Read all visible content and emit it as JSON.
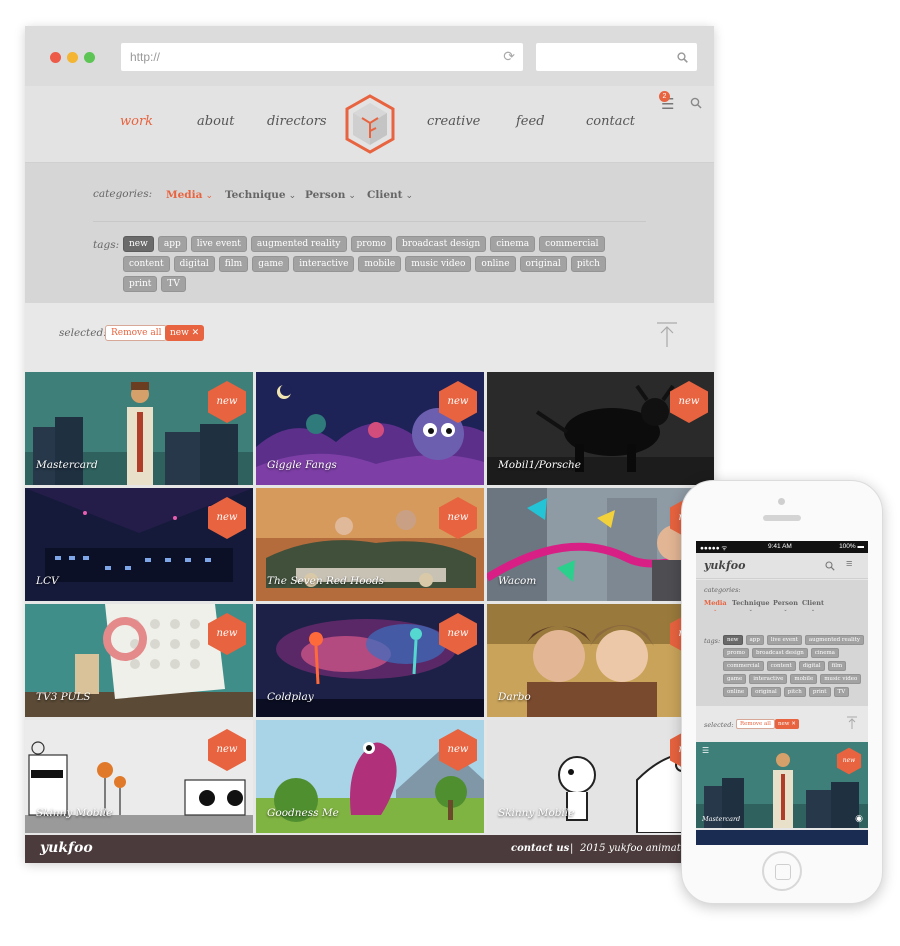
{
  "browser": {
    "url": "http://"
  },
  "nav": {
    "items": [
      {
        "label": "work",
        "active": true
      },
      {
        "label": "about"
      },
      {
        "label": "directors"
      },
      {
        "label": "creative"
      },
      {
        "label": "feed"
      },
      {
        "label": "contact"
      }
    ],
    "notification_count": "2"
  },
  "filters": {
    "categories_label": "categories:",
    "categories": [
      {
        "label": "Media",
        "active": true
      },
      {
        "label": "Technique"
      },
      {
        "label": "Person"
      },
      {
        "label": "Client"
      }
    ],
    "tags_label": "tags:",
    "tags": [
      "new",
      "app",
      "live event",
      "augmented reality",
      "promo",
      "broadcast design",
      "cinema",
      "commercial",
      "content",
      "digital",
      "film",
      "game",
      "interactive",
      "mobile",
      "music video",
      "online",
      "original",
      "pitch",
      "print",
      "TV"
    ],
    "active_tag": "new"
  },
  "selected": {
    "label": "selected:",
    "remove_all": "Remove all",
    "chip": "new ✕"
  },
  "tiles": [
    {
      "name": "Mastercard",
      "badge": "new"
    },
    {
      "name": "Giggle Fangs",
      "badge": "new"
    },
    {
      "name": "Mobil1/Porsche",
      "badge": "new"
    },
    {
      "name": "LCV",
      "badge": "new"
    },
    {
      "name": "The Seven Red Hoods",
      "badge": "new"
    },
    {
      "name": "Wacom",
      "badge": "new"
    },
    {
      "name": "TV3 PULS",
      "badge": "new"
    },
    {
      "name": "Coldplay",
      "badge": "new"
    },
    {
      "name": "Darbo",
      "badge": "new"
    },
    {
      "name": "Skinny Mobile",
      "badge": "new"
    },
    {
      "name": "Goodness Me",
      "badge": "new"
    },
    {
      "name": "Skinny Mobile",
      "badge": "new"
    }
  ],
  "footer": {
    "brand": "yukfoo",
    "contact": "contact us",
    "separator": "|",
    "copyright": "2015 yukfoo animation st"
  },
  "phone": {
    "status": {
      "signal": "●●●●● ᯤ",
      "time": "9:41 AM",
      "battery": "100% ▬"
    },
    "brand": "yukfoo",
    "categories_label": "categories:",
    "categories": [
      "Media",
      "Technique",
      "Person",
      "Client"
    ],
    "tags_label": "tags:",
    "tags": [
      "new",
      "app",
      "live event",
      "augmented reality",
      "promo",
      "broadcast design",
      "cinema",
      "commercial",
      "content",
      "digital",
      "film",
      "game",
      "interactive",
      "mobile",
      "music video",
      "online",
      "original",
      "pitch",
      "print",
      "TV"
    ],
    "selected_label": "selected:",
    "remove_all": "Remove all",
    "chip": "new ✕",
    "tile": {
      "name": "Mastercard",
      "badge": "new"
    }
  },
  "colors": {
    "accent": "#e8633f",
    "footer": "#4b3b3c",
    "header": "#e3e3e3",
    "filters": "#d6d6d6"
  }
}
